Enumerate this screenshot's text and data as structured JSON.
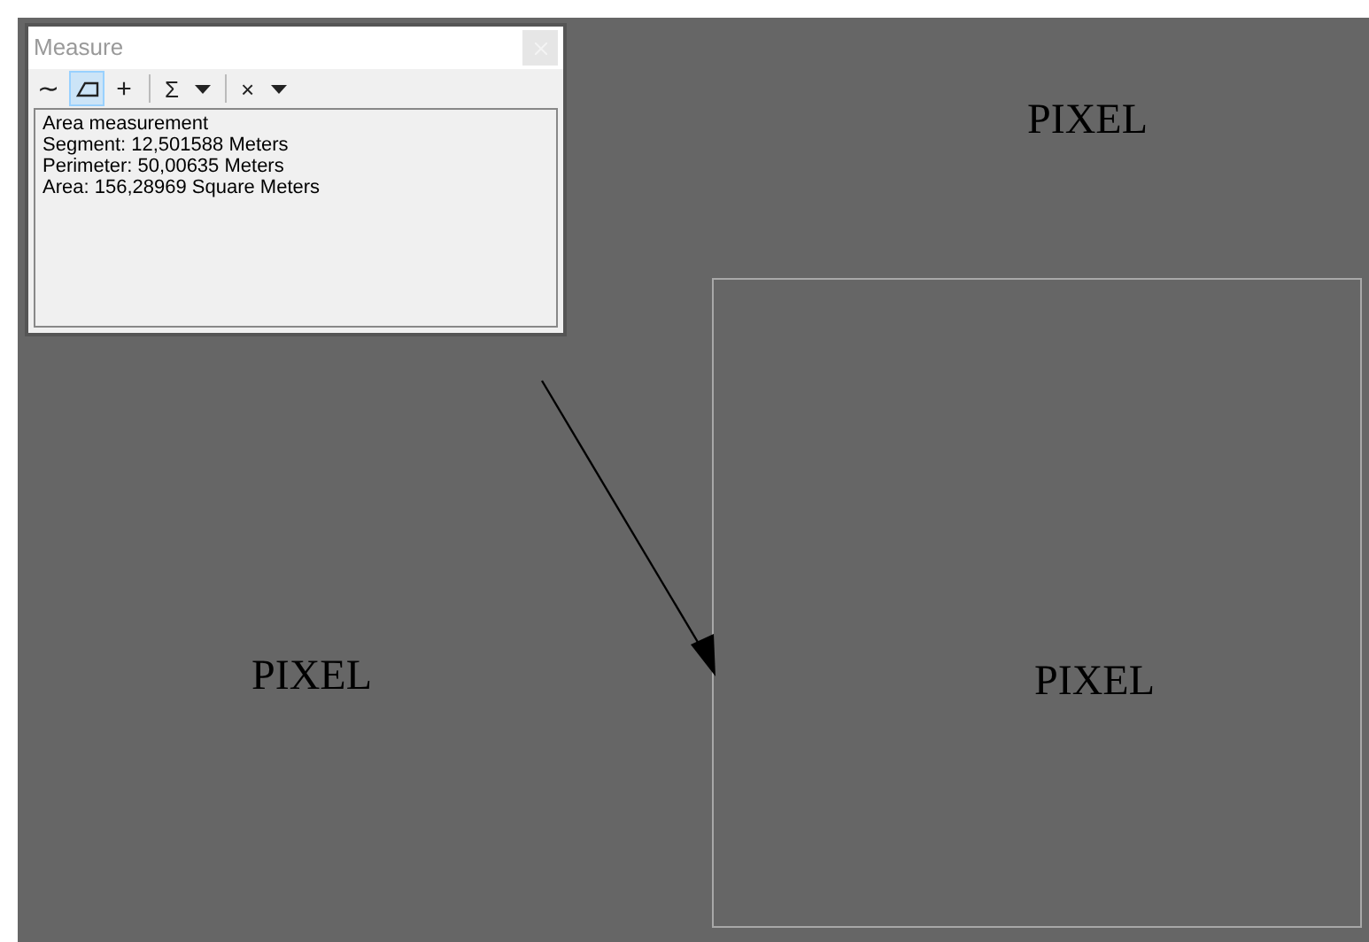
{
  "window": {
    "title": "Measure"
  },
  "toolbar": [
    {
      "kind": "glyph",
      "label": "∼",
      "selected": false
    },
    {
      "kind": "polygon",
      "selected": true
    },
    {
      "kind": "glyph",
      "label": "+",
      "selected": false
    },
    {
      "kind": "separator"
    },
    {
      "kind": "menu",
      "label": "Σ"
    },
    {
      "kind": "separator"
    },
    {
      "kind": "menu",
      "label": "×"
    }
  ],
  "results": [
    "Area measurement",
    "Segment: 12,501588 Meters",
    "Perimeter: 50,00635 Meters",
    "Area: 156,28969 Square Meters"
  ],
  "map_labels": [
    "PIXEL",
    "PIXEL",
    "PIXEL"
  ]
}
